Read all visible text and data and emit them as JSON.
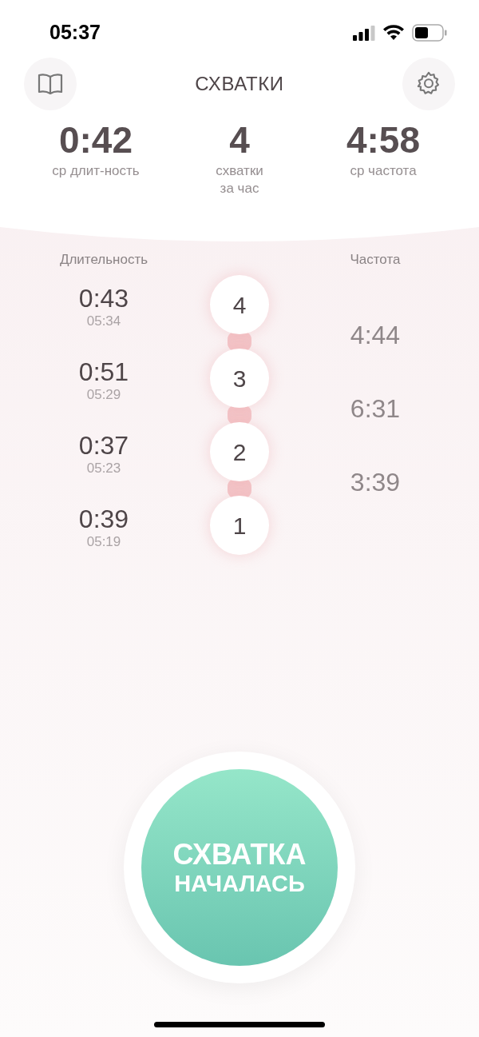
{
  "status_bar": {
    "time": "05:37"
  },
  "header": {
    "title": "СХВАТКИ"
  },
  "stats": [
    {
      "value": "0:42",
      "label": "ср длит-ность"
    },
    {
      "value": "4",
      "label": "схватки\nза час"
    },
    {
      "value": "4:58",
      "label": "ср частота"
    }
  ],
  "columns": {
    "duration": "Длительность",
    "frequency": "Частота"
  },
  "contractions": [
    {
      "number": "4",
      "duration": "0:43",
      "start": "05:34"
    },
    {
      "number": "3",
      "duration": "0:51",
      "start": "05:29"
    },
    {
      "number": "2",
      "duration": "0:37",
      "start": "05:23"
    },
    {
      "number": "1",
      "duration": "0:39",
      "start": "05:19"
    }
  ],
  "frequencies": [
    "4:44",
    "6:31",
    "3:39"
  ],
  "main_button": {
    "line_1": "СХВАТКА",
    "line_2": "НАЧАЛАСЬ"
  }
}
